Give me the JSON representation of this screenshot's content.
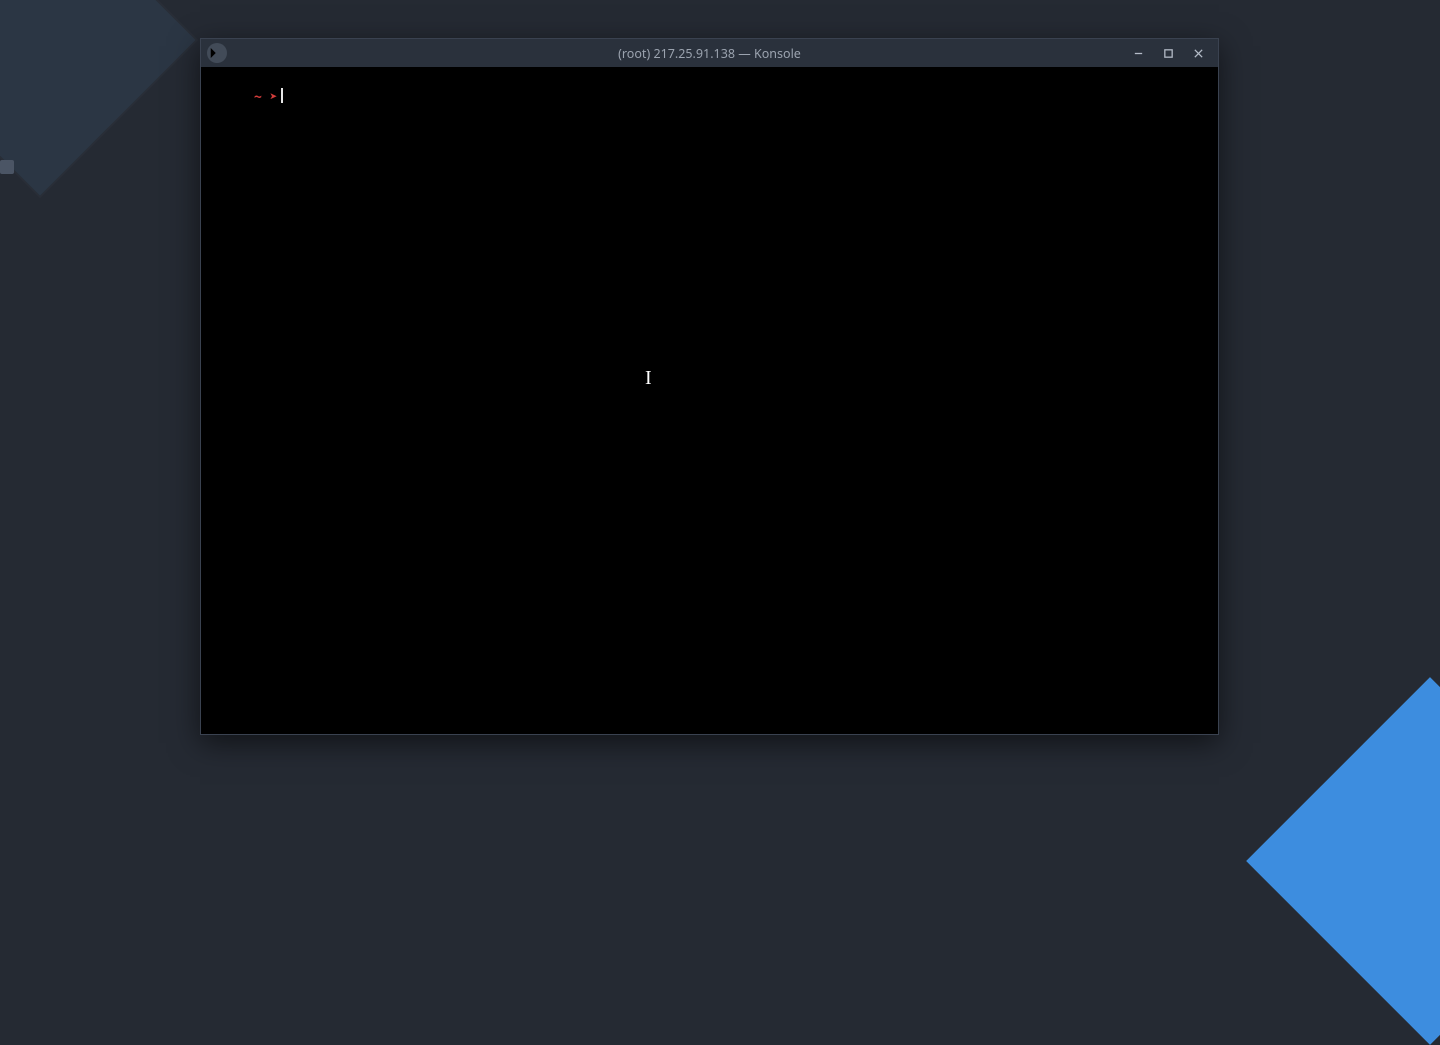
{
  "window": {
    "title": "(root) 217.25.91.138 — Konsole",
    "app_icon": "terminal-icon"
  },
  "terminal": {
    "prompt_cwd": "~",
    "prompt_arrow": "➤",
    "command_input": ""
  }
}
